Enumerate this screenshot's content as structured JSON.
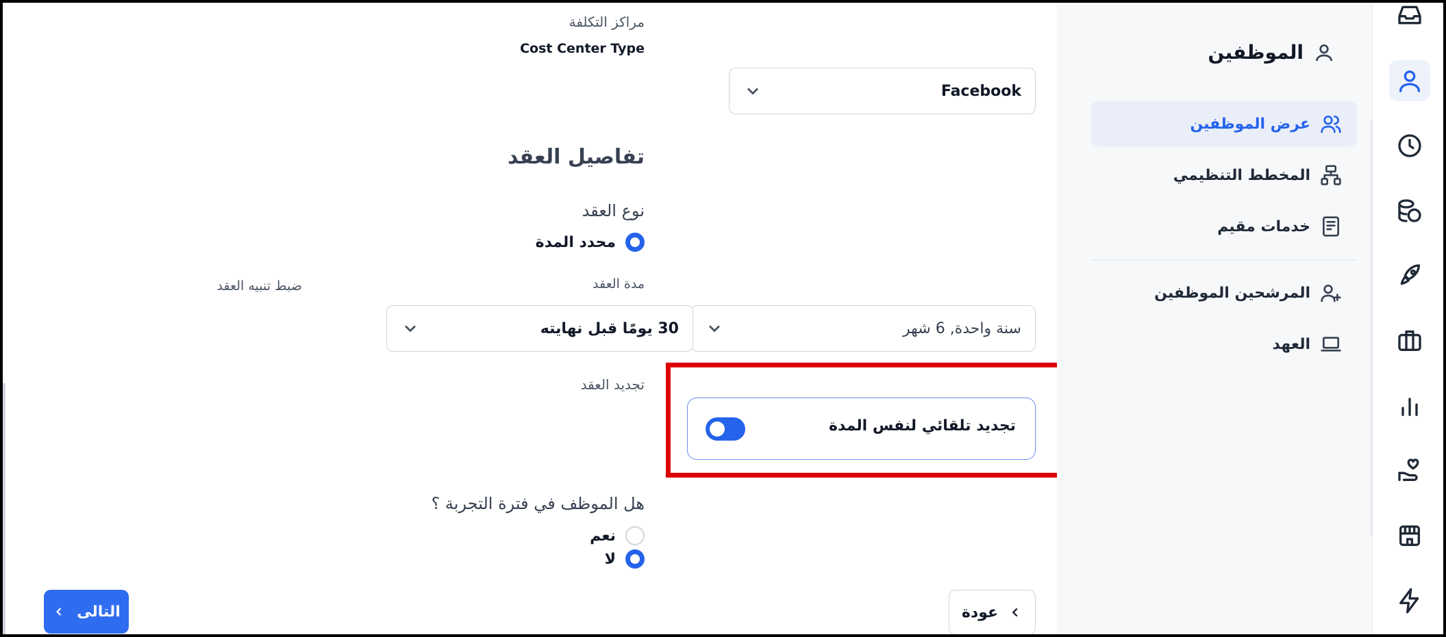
{
  "sidebar": {
    "title": "الموظفين",
    "items": [
      {
        "label": "عرض الموظفين",
        "icon": "users-icon",
        "active": true
      },
      {
        "label": "المخطط التنظيمي",
        "icon": "org-chart-icon",
        "active": false
      },
      {
        "label": "خدمات مقيم",
        "icon": "document-icon",
        "active": false
      },
      {
        "label": "المرشحين الموظفين",
        "icon": "user-plus-icon",
        "active": false
      },
      {
        "label": "العهد",
        "icon": "laptop-icon",
        "active": false
      }
    ]
  },
  "rail": {
    "icons": [
      "inbox-icon",
      "user-icon",
      "clock-icon",
      "coins-icon",
      "rocket-icon",
      "briefcase-icon",
      "bar-chart-icon",
      "hand-heart-icon",
      "store-icon",
      "lightning-icon"
    ],
    "active": "user-icon"
  },
  "form": {
    "cost_centers_label": "مراكز التكلفة",
    "cost_center_type_label": "Cost Center Type",
    "cost_center_type_value": "Facebook",
    "contract_details_heading": "تفاصيل العقد",
    "contract_type_label": "نوع العقد",
    "contract_type_option": "محدد المدة",
    "contract_duration_label": "مدة العقد",
    "contract_duration_value": "سنة واحدة, 6 شهر",
    "contract_alert_label": "ضبط تنبيه العقد",
    "contract_alert_value": "30 يومًا قبل نهايته",
    "contract_renewal_label": "تجديد العقد",
    "auto_renew_label": "تجديد تلقائي لنفس المدة",
    "auto_renew_enabled": true,
    "probation_question": "هل الموظف في فترة التجربة ؟",
    "probation_yes": "نعم",
    "probation_no": "لا",
    "probation_selected": "no"
  },
  "buttons": {
    "back_label": "عودة",
    "next_label": "التالى"
  },
  "colors": {
    "accent": "#2563eb",
    "highlight": "#dc0000"
  }
}
